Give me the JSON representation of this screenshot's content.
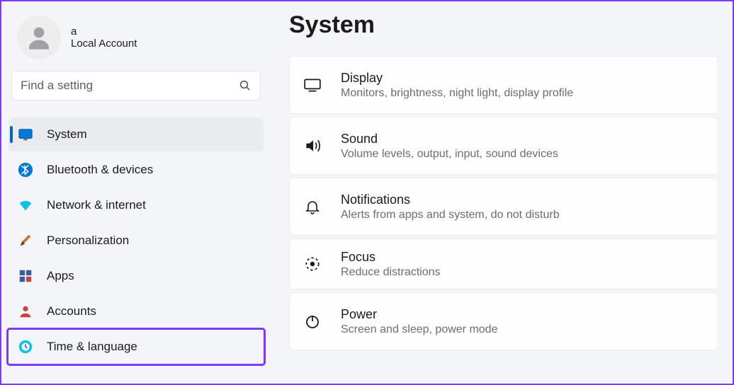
{
  "account": {
    "name": "a",
    "type": "Local Account"
  },
  "search": {
    "placeholder": "Find a setting"
  },
  "sidebar": {
    "items": [
      {
        "label": "System",
        "icon": "system"
      },
      {
        "label": "Bluetooth & devices",
        "icon": "bluetooth"
      },
      {
        "label": "Network & internet",
        "icon": "wifi"
      },
      {
        "label": "Personalization",
        "icon": "brush"
      },
      {
        "label": "Apps",
        "icon": "apps"
      },
      {
        "label": "Accounts",
        "icon": "person"
      },
      {
        "label": "Time & language",
        "icon": "clock"
      }
    ]
  },
  "main": {
    "title": "System",
    "cards": [
      {
        "title": "Display",
        "desc": "Monitors, brightness, night light, display profile",
        "icon": "display"
      },
      {
        "title": "Sound",
        "desc": "Volume levels, output, input, sound devices",
        "icon": "sound"
      },
      {
        "title": "Notifications",
        "desc": "Alerts from apps and system, do not disturb",
        "icon": "bell"
      },
      {
        "title": "Focus",
        "desc": "Reduce distractions",
        "icon": "focus"
      },
      {
        "title": "Power",
        "desc": "Screen and sleep, power mode",
        "icon": "power"
      }
    ]
  }
}
